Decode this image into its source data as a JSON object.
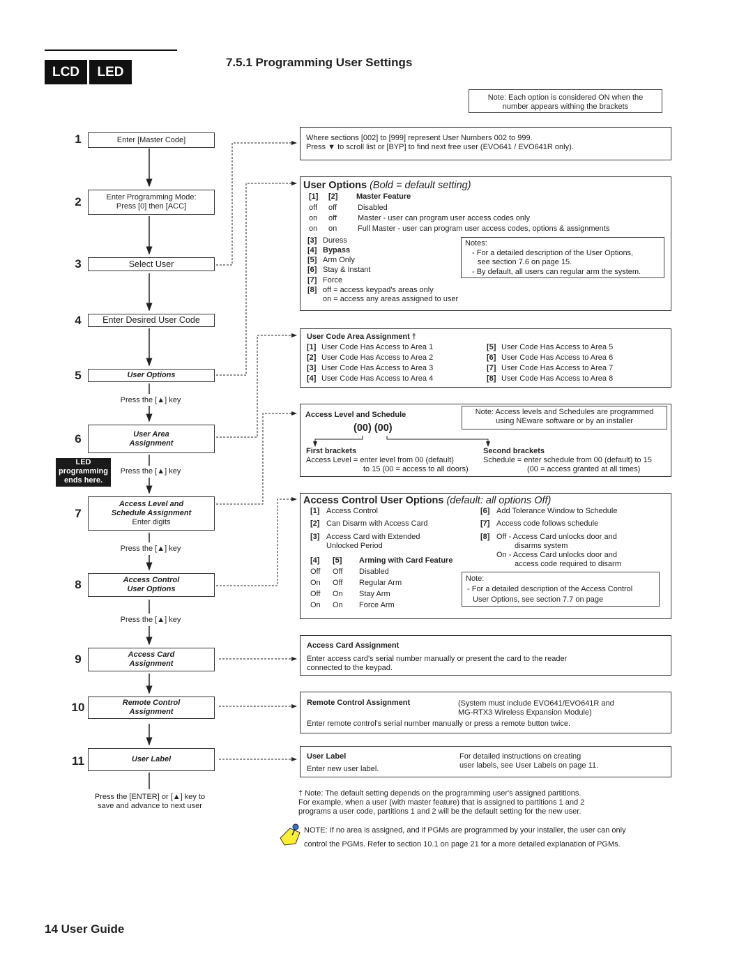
{
  "header": {
    "tabs": [
      "LCD",
      "LED"
    ],
    "section_title": "7.5.1  Programming User Settings",
    "top_note": [
      "Note:  Each option is considered ON when the",
      "number appears withing the brackets"
    ]
  },
  "steps": [
    {
      "num": "1",
      "lines": [
        "Enter [Master Code]"
      ]
    },
    {
      "num": "2",
      "lines": [
        "Enter Programming Mode:",
        "Press [0] then [ACC]"
      ]
    },
    {
      "num": "3",
      "lines": [
        "Select User"
      ]
    },
    {
      "num": "4",
      "lines": [
        "Enter Desired User Code"
      ]
    },
    {
      "num": "5",
      "lines": [
        "User Options"
      ]
    },
    {
      "num": "6",
      "lines": [
        "User Area",
        "Assignment"
      ]
    },
    {
      "num": "7",
      "lines": [
        "Access Level and",
        "Schedule Assignment",
        "Enter digits"
      ]
    },
    {
      "num": "8",
      "lines": [
        "Access Control",
        "User Options"
      ]
    },
    {
      "num": "9",
      "lines": [
        "Access Card",
        "Assignment"
      ]
    },
    {
      "num": "10",
      "lines": [
        "Remote Control",
        "Assignment"
      ]
    },
    {
      "num": "11",
      "lines": [
        "User Label"
      ]
    }
  ],
  "press_key": "Press the [▲] key",
  "led_badge": [
    "LED",
    "programming",
    "ends here."
  ],
  "final_press": [
    "Press the [ENTER] or [▲] key to",
    "save and advance to next user"
  ],
  "box_sections": [
    "Where sections [002] to [999] represent User Numbers 002 to 999.",
    "Press ▼ to scroll list or [BYP] to find next free user (EVO641 / EVO641R only)."
  ],
  "user_options": {
    "title": "User Options",
    "subtitle": "(Bold = default setting)",
    "head": [
      "[1]",
      "[2]",
      "Master Feature"
    ],
    "rows": [
      [
        "off",
        "off",
        "Disabled"
      ],
      [
        "on",
        "off",
        "Master - user can program user access codes only"
      ],
      [
        "on",
        "on",
        "Full Master - user can program user access codes, options & assignments"
      ]
    ],
    "opts": [
      [
        "[3]",
        "Duress"
      ],
      [
        "[4]",
        "Bypass"
      ],
      [
        "[5]",
        "Arm Only"
      ],
      [
        "[6]",
        "Stay & Instant"
      ],
      [
        "[7]",
        "Force"
      ],
      [
        "[8]",
        "off = access keypad's areas only"
      ]
    ],
    "opt8_on": "on = access any areas assigned to user",
    "notes": [
      "Notes:",
      "- For a detailed description of the User Options,",
      "see section 7.6 on page 15.",
      "- By default, all users can regular arm the system."
    ]
  },
  "area_assignment": {
    "title": "User Code Area Assignment †",
    "items": [
      [
        "[1]",
        "User Code Has Access to Area 1"
      ],
      [
        "[2]",
        "User Code Has Access to Area 2"
      ],
      [
        "[3]",
        "User Code Has Access to Area 3"
      ],
      [
        "[4]",
        "User Code Has Access to Area 4"
      ],
      [
        "[5]",
        "User Code Has Access to Area 5"
      ],
      [
        "[6]",
        "User Code Has Access to Area 6"
      ],
      [
        "[7]",
        "User Code Has Access to Area 7"
      ],
      [
        "[8]",
        "User Code Has Access to Area 8"
      ]
    ]
  },
  "access_level": {
    "title": "Access Level and Schedule",
    "brackets": "(00)  (00)",
    "note": [
      "Note:  Access levels and Schedules are programmed",
      "using NEware software or by an installer"
    ],
    "first": [
      "First brackets",
      "Access Level = enter level from 00 (default)",
      "to 15 (00 = access to all doors)"
    ],
    "second": [
      "Second brackets",
      "Schedule = enter schedule from 00 (default) to 15",
      "(00 = access granted at all times)"
    ]
  },
  "access_control": {
    "title": "Access Control User Options",
    "subtitle": "(default: all options Off)",
    "left": [
      [
        "[1]",
        "Access Control"
      ],
      [
        "[2]",
        "Can Disarm with Access Card"
      ],
      [
        "[3]",
        "Access Card with Extended"
      ]
    ],
    "left3b": "Unlocked Period",
    "right": [
      [
        "[6]",
        "Add Tolerance Window to Schedule"
      ],
      [
        "[7]",
        "Access code follows schedule"
      ],
      [
        "[8]",
        "Off - Access Card unlocks door and"
      ]
    ],
    "right8": [
      "disarms system",
      "On - Access Card unlocks door and",
      "access code required to disarm"
    ],
    "head": [
      "[4]",
      "[5]",
      "Arming with Card Feature"
    ],
    "rows": [
      [
        "Off",
        "Off",
        "Disabled"
      ],
      [
        "On",
        "Off",
        "Regular Arm"
      ],
      [
        "Off",
        "On",
        "Stay Arm"
      ],
      [
        "On",
        "On",
        "Force Arm"
      ]
    ],
    "note": [
      "Note:",
      "- For a detailed description of the Access Control",
      "User Options, see section 7.7 on page"
    ]
  },
  "card": {
    "title": "Access Card Assignment",
    "lines": [
      "Enter access card's serial number manually or present the card to the reader",
      "connected to the keypad."
    ]
  },
  "remote": {
    "title": "Remote Control Assignment",
    "aside": [
      "(System must include EVO641/EVO641R and",
      "MG-RTX3 Wireless Expansion Module)"
    ],
    "line": "Enter remote control's serial number manually or press a remote button twice."
  },
  "label": {
    "title": "User Label",
    "line": "Enter new user label.",
    "aside": [
      "For detailed instructions on creating",
      "user labels, see User Labels on page 11."
    ]
  },
  "footnote": [
    "† Note: The default setting depends on the programming user's assigned partitions.",
    "For example, when a user (with master feature) that is assigned to partitions 1 and 2",
    "programs a user code, partitions 1 and 2 will be the default setting for the new user."
  ],
  "pgm_note": [
    "NOTE: If no area is assigned, and if PGMs are programmed by your installer, the user can only",
    "control the PGMs. Refer to section 10.1 on page 21 for a more detailed explanation of PGMs."
  ],
  "footer": "14 User Guide",
  "icons": {
    "note": "pushpin-note-icon"
  }
}
